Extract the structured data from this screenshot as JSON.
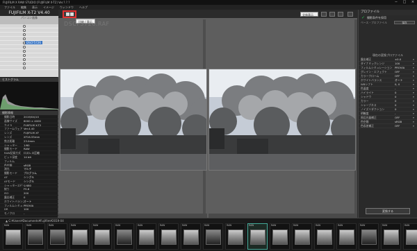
{
  "window": {
    "title": "FUJIFILM X RAW STUDIO    [FUJIFILM X-T2]    Ver.?.?.?",
    "controls": [
      "−",
      "□",
      "×"
    ]
  },
  "menu": [
    "ファイル",
    "編集",
    "表示",
    "イメージ",
    "ウィンドウ",
    "ヘルプ"
  ],
  "left": {
    "camera_label": "FUJIFILM X-T2   V4.40",
    "tree_header": "パソコン画像",
    "tree_rows": [
      "",
      "",
      "",
      "",
      "DSCF5726",
      "",
      "",
      "",
      "",
      "",
      ""
    ],
    "selected_row": "DSCF5726",
    "histogram_label": "ヒストグラム",
    "info_label": "撮影情報",
    "info_rows": [
      {
        "k": "撮影日時",
        "v": "2019/04/10"
      },
      {
        "k": "画像サイズ",
        "v": "6000 × 4000"
      },
      {
        "k": "カメラ",
        "v": "FUJIFILM X-T2"
      },
      {
        "k": "ファームウェア",
        "v": "Ver.4.40"
      },
      {
        "k": "レンズ",
        "v": "FUJIFILM XF"
      },
      {
        "k": "レンズ",
        "v": "XF16-55mm"
      },
      {
        "k": "焦点距離",
        "v": "23.0mm"
      },
      {
        "k": "シャッター",
        "v": "1/60"
      },
      {
        "k": "撮影モード",
        "v": "RAW"
      },
      {
        "k": "RAW記録方式",
        "v": "ロスレス圧縮"
      },
      {
        "k": "ビット深度",
        "v": "14 bit"
      },
      {
        "k": "フィルム",
        "v": ""
      },
      {
        "k": "色空間",
        "v": "sRGB"
      },
      {
        "k": "測光",
        "v": "マルチ"
      },
      {
        "k": "撮影モード",
        "v": "プログラム"
      },
      {
        "k": "AF",
        "v": "シングル"
      },
      {
        "k": "AFモード",
        "v": "シングル"
      },
      {
        "k": "シャッタースピード",
        "v": "1/480"
      },
      {
        "k": "絞り",
        "v": "F5.6"
      },
      {
        "k": "ISO",
        "v": "200"
      },
      {
        "k": "露出補正",
        "v": "0"
      },
      {
        "k": "ホワイトバランス",
        "v": "オート"
      },
      {
        "k": "フィルムシミュ",
        "v": "PROVIA"
      },
      {
        "k": "DR",
        "v": "100"
      },
      {
        "k": "モノクロ",
        "v": "-"
      }
    ]
  },
  "toolbar": {
    "compare_tooltip": "比較 / 表示",
    "zoom_value": "全体表示",
    "filename": "DSCF5726.RAF"
  },
  "right": {
    "panel_title": "プロファイル",
    "check_label": "撮影条件を採用",
    "profile_label": "ベース・プロファイル",
    "profile_btn": "保存",
    "section_label": "現在の変換プロファイル",
    "rows": [
      {
        "k": "露出補正",
        "v": "±0.0"
      },
      {
        "k": "ダイナミックレンジ",
        "v": "100"
      },
      {
        "k": "フィルムシミュレーション",
        "v": "PROVIA"
      },
      {
        "k": "グレイン・エフェクト",
        "v": "OFF"
      },
      {
        "k": "カラークローム",
        "v": "OFF"
      },
      {
        "k": "ホワイトバランス",
        "v": "オート"
      },
      {
        "k": "WBシフト",
        "v": "0, 0"
      },
      {
        "k": "色温度",
        "v": "-"
      },
      {
        "k": "ハイライト",
        "v": "0"
      },
      {
        "k": "シャドウ",
        "v": "0"
      },
      {
        "k": "カラー",
        "v": "0"
      },
      {
        "k": "シャープネス",
        "v": "0"
      },
      {
        "k": "ノイズリダクション",
        "v": "0"
      },
      {
        "k": "明瞭度",
        "v": "-"
      },
      {
        "k": "周辺光量補正",
        "v": "OFF"
      },
      {
        "k": "色空間",
        "v": "sRGB"
      },
      {
        "k": "色収差補正",
        "v": "OFF"
      }
    ],
    "save_label": "変換する"
  },
  "filmstrip": {
    "path": "▲ C:¥Users¥Documents¥Fujifilm¥2019-04",
    "thumbs": [
      {
        "a": "RAW",
        "b": "",
        "d": false
      },
      {
        "a": "RAW",
        "b": "",
        "d": true
      },
      {
        "a": "RAW",
        "b": "",
        "d": true
      },
      {
        "a": "RAW",
        "b": "",
        "d": false
      },
      {
        "a": "RAW",
        "b": "",
        "d": false
      },
      {
        "a": "RAW",
        "b": "",
        "d": true
      },
      {
        "a": "RAW",
        "b": "",
        "d": false
      },
      {
        "a": "RAW",
        "b": "",
        "d": false
      },
      {
        "a": "RAW",
        "b": "",
        "d": false
      },
      {
        "a": "RAW",
        "b": "",
        "d": true
      },
      {
        "a": "RAW",
        "b": "",
        "d": false
      },
      {
        "a": "RAW",
        "b": "",
        "d": false
      },
      {
        "a": "RAW",
        "b": "",
        "d": false
      },
      {
        "a": "RAW",
        "b": "",
        "d": false
      },
      {
        "a": "RAW",
        "b": "",
        "d": false
      },
      {
        "a": "RAW",
        "b": "",
        "d": false
      },
      {
        "a": "RAW",
        "b": "",
        "d": true
      },
      {
        "a": "RAW",
        "b": "",
        "d": false
      },
      {
        "a": "RAW",
        "b": "",
        "d": false
      }
    ],
    "selected_index": 11
  },
  "colors": {
    "accent": "#3a76c4",
    "highlight": "#e23030",
    "ok": "#29c24f"
  }
}
